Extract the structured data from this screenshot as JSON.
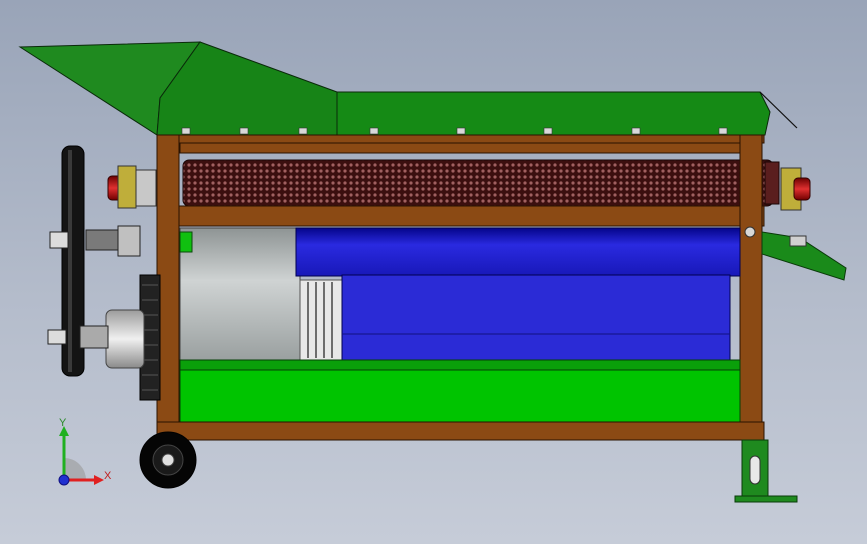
{
  "view": {
    "background_top": "#99a4b8",
    "background_bottom": "#c6ccd8"
  },
  "model": {
    "frame_color": "#8b4a14",
    "guard_color": "#1f8a1f",
    "tray_color": "#00c400",
    "motor_color": "#2b2bd6",
    "screen_color": "#5a1e1e"
  },
  "triad": {
    "x_label": "X",
    "y_label": "Y",
    "x_color": "#e02020",
    "y_color": "#20b020",
    "z_color": "#2030d0"
  }
}
